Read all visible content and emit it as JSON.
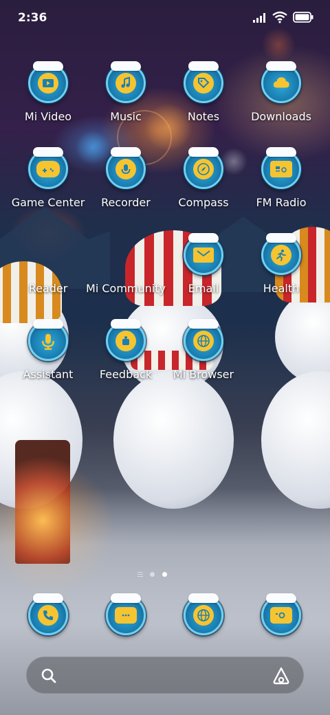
{
  "status_bar": {
    "time": "2:36",
    "icons": [
      "cellular-signal-icon",
      "wifi-icon",
      "battery-icon"
    ]
  },
  "apps": [
    {
      "label": "Mi Video",
      "icon": "video-play-icon"
    },
    {
      "label": "Music",
      "icon": "music-note-icon"
    },
    {
      "label": "Notes",
      "icon": "tag-icon"
    },
    {
      "label": "Downloads",
      "icon": "cloud-icon"
    },
    {
      "label": "Game Center",
      "icon": "gamepad-icon"
    },
    {
      "label": "Recorder",
      "icon": "microphone-icon"
    },
    {
      "label": "Compass",
      "icon": "compass-icon"
    },
    {
      "label": "FM Radio",
      "icon": "radio-icon"
    },
    {
      "label": "Reader",
      "icon": null
    },
    {
      "label": "Mi Community",
      "icon": null
    },
    {
      "label": "Email",
      "icon": "envelope-icon"
    },
    {
      "label": "Health",
      "icon": "running-person-icon"
    },
    {
      "label": "Assistant",
      "icon": "microphone-icon"
    },
    {
      "label": "Feedback",
      "icon": "feedback-icon"
    },
    {
      "label": "Mi Browser",
      "icon": "globe-icon"
    }
  ],
  "page_indicator": {
    "pages": 2,
    "current": 2
  },
  "dock": [
    {
      "icon": "phone-icon"
    },
    {
      "icon": "message-icon"
    },
    {
      "icon": "globe-icon"
    },
    {
      "icon": "camera-icon"
    }
  ],
  "search_bar": {
    "icons": [
      "search-icon",
      "assistant-icon"
    ]
  },
  "colors": {
    "icon_ring": "#6fd0f0",
    "icon_fill": "#1b7fb2",
    "glyph": "#f6c431"
  }
}
